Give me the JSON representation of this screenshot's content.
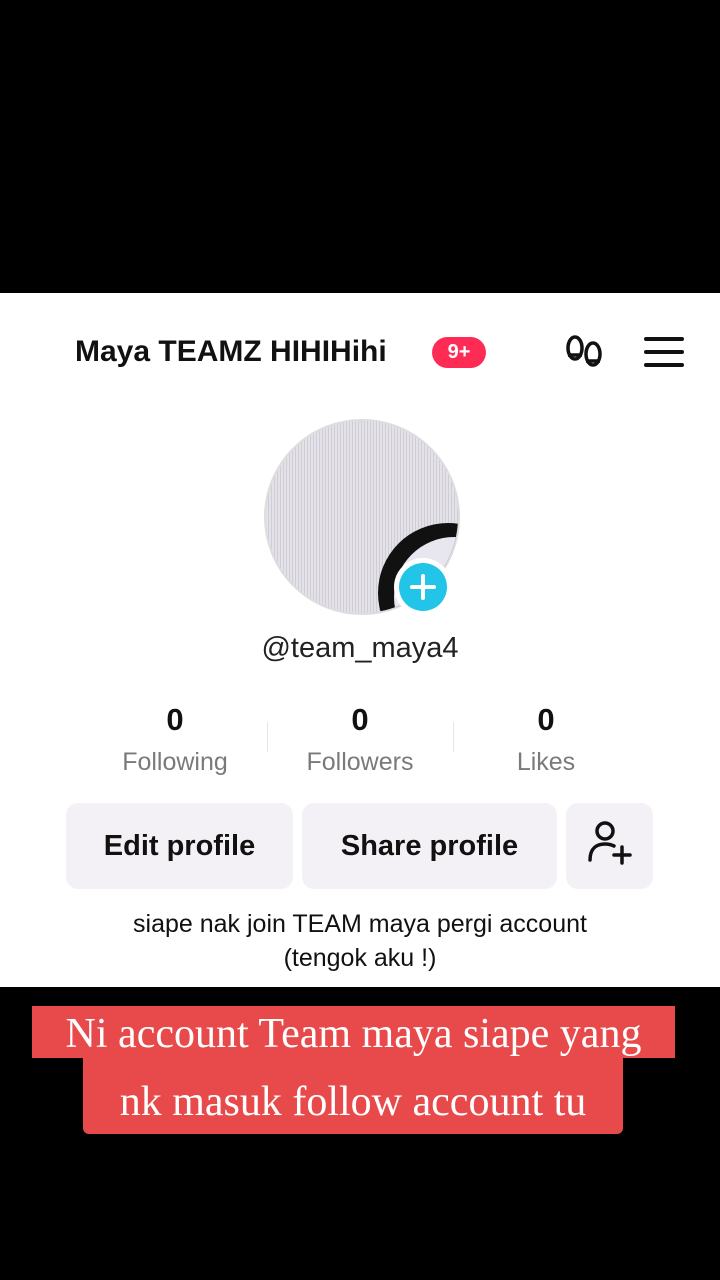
{
  "header": {
    "username": "Maya TEAMZ HIHIHihi",
    "notification_badge": "9+"
  },
  "profile": {
    "handle": "@team_maya4",
    "avatar_add_icon": "plus-icon"
  },
  "stats": [
    {
      "value": "0",
      "label": "Following"
    },
    {
      "value": "0",
      "label": "Followers"
    },
    {
      "value": "0",
      "label": "Likes"
    }
  ],
  "actions": {
    "edit_label": "Edit profile",
    "share_label": "Share profile",
    "add_friend_icon": "add-person-icon"
  },
  "bio": {
    "line1": "siape nak join TEAM maya pergi account",
    "line2": "(tengok aku !)"
  },
  "caption": {
    "line1": "Ni account Team maya siape yang",
    "line2": "nk masuk follow account tu"
  },
  "colors": {
    "badge": "#fe2c55",
    "add_button": "#22c5e8",
    "caption_bg": "#e84a4b"
  }
}
